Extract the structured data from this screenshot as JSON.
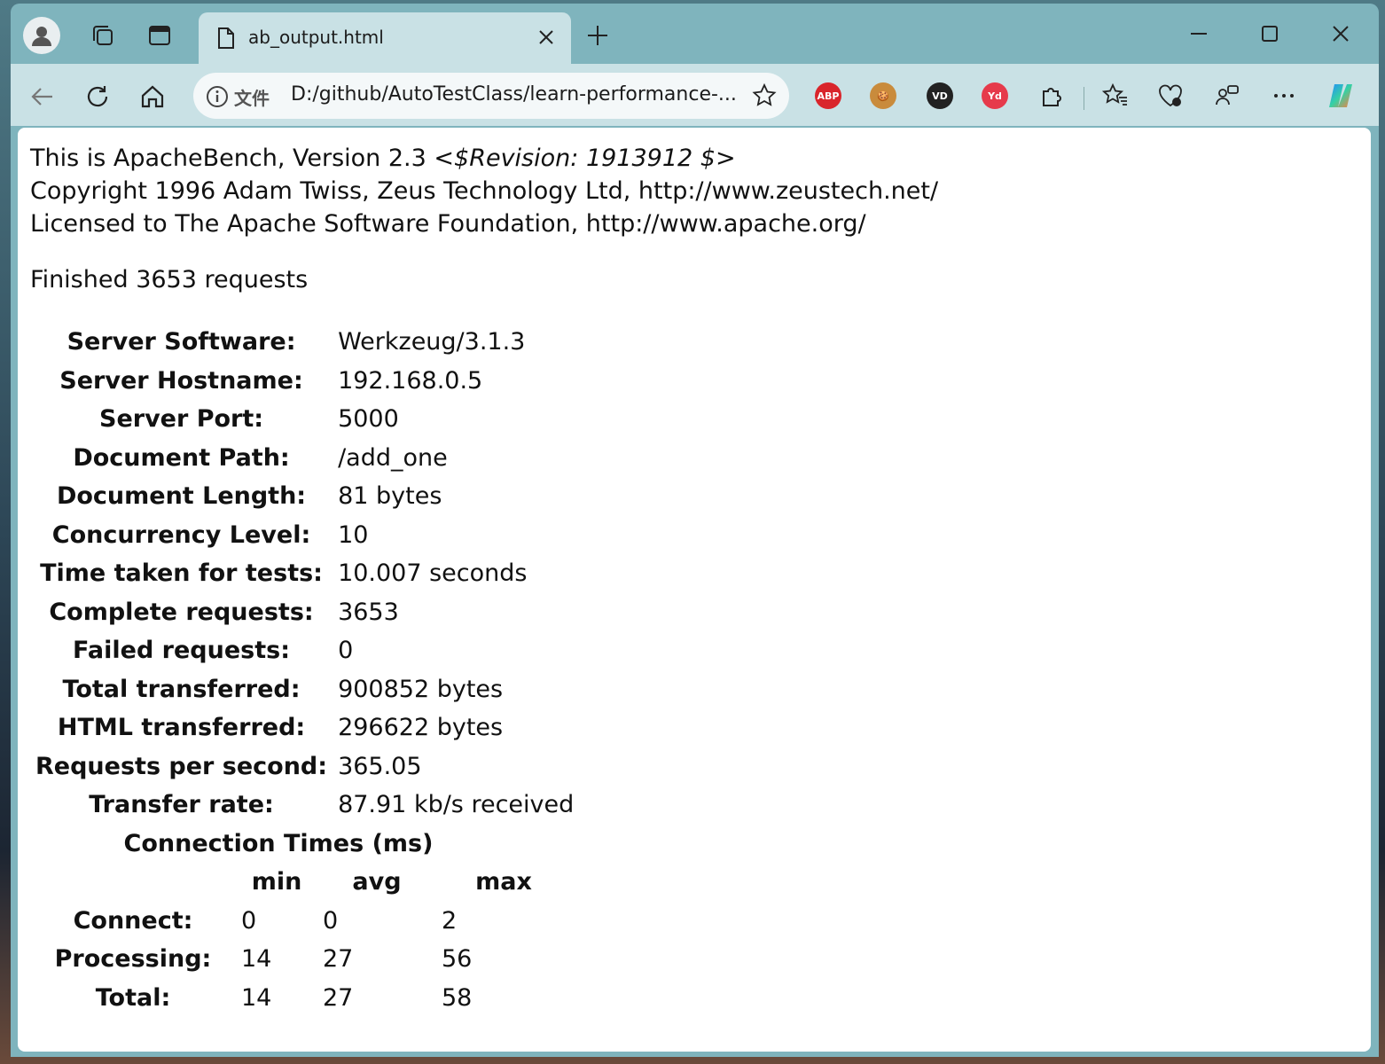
{
  "browser": {
    "tab_title": "ab_output.html",
    "address_label": "文件",
    "address_url": "D:/github/AutoTestClass/learn-performance-..."
  },
  "extensions": [
    {
      "name": "adblock-plus",
      "label": "ABP",
      "color": "#d9252b"
    },
    {
      "name": "cookie",
      "label": "",
      "color": "#c98b3c"
    },
    {
      "name": "vd",
      "label": "VD",
      "color": "#222222"
    },
    {
      "name": "yd",
      "label": "Yd",
      "color": "#e63a4b"
    }
  ],
  "page": {
    "header_line1": "This is ApacheBench, Version 2.3",
    "header_revision": "<$Revision: 1913912 $>",
    "header_line2": "Copyright 1996 Adam Twiss, Zeus Technology Ltd, http://www.zeustech.net/",
    "header_line3": "Licensed to The Apache Software Foundation, http://www.apache.org/",
    "finished": "Finished 3653 requests",
    "rows": [
      {
        "label": "Server Software:",
        "value": "Werkzeug/3.1.3"
      },
      {
        "label": "Server Hostname:",
        "value": "192.168.0.5"
      },
      {
        "label": "Server Port:",
        "value": "5000"
      },
      {
        "label": "Document Path:",
        "value": "/add_one"
      },
      {
        "label": "Document Length:",
        "value": "81 bytes"
      },
      {
        "label": "Concurrency Level:",
        "value": "10"
      },
      {
        "label": "Time taken for tests:",
        "value": "10.007 seconds"
      },
      {
        "label": "Complete requests:",
        "value": "3653"
      },
      {
        "label": "Failed requests:",
        "value": "0"
      },
      {
        "label": "Total transferred:",
        "value": "900852 bytes"
      },
      {
        "label": "HTML transferred:",
        "value": "296622 bytes"
      },
      {
        "label": "Requests per second:",
        "value": "365.05"
      },
      {
        "label": "Transfer rate:",
        "value": "87.91 kb/s received"
      }
    ],
    "connection_title": "Connection Times (ms)",
    "conn_headers": [
      "",
      "min",
      "avg",
      "max"
    ],
    "conn_rows": [
      {
        "label": "Connect:",
        "min": "0",
        "avg": "0",
        "max": "2"
      },
      {
        "label": "Processing:",
        "min": "14",
        "avg": "27",
        "max": "56"
      },
      {
        "label": "Total:",
        "min": "14",
        "avg": "27",
        "max": "58"
      }
    ]
  }
}
